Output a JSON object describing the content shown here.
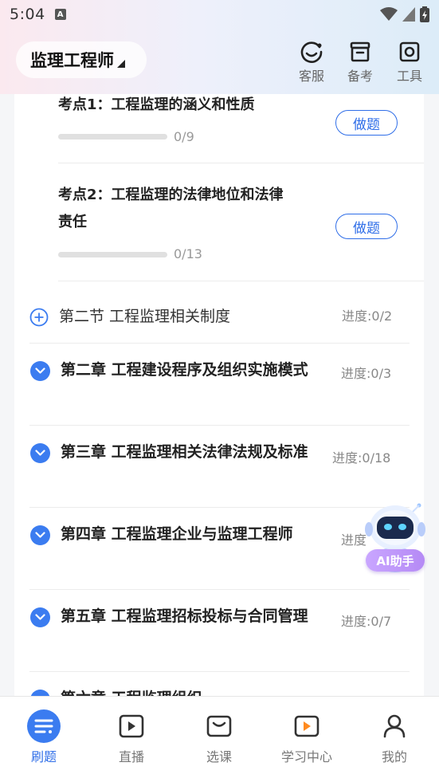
{
  "status": {
    "time": "5:04",
    "notif_letter": "A"
  },
  "header": {
    "title": "监理工程师",
    "buttons": [
      {
        "label": "客服",
        "icon": "customer-service-icon"
      },
      {
        "label": "备考",
        "icon": "archive-box-icon"
      },
      {
        "label": "工具",
        "icon": "toolbox-icon"
      }
    ]
  },
  "knowledge_points": [
    {
      "title": "考点1：工程监理的涵义和性质",
      "count": "0/9",
      "progress": 0,
      "action": "做题"
    },
    {
      "title": "考点2：工程监理的法律地位和法律责任",
      "count": "0/13",
      "progress": 0,
      "action": "做题"
    }
  ],
  "section": {
    "title": "第二节 工程监理相关制度",
    "progress": "进度:0/2"
  },
  "chapters": [
    {
      "title": "第二章 工程建设程序及组织实施模式",
      "progress": "进度:0/3"
    },
    {
      "title": "第三章 工程监理相关法律法规及标准",
      "progress": "进度:0/18"
    },
    {
      "title": "第四章 工程监理企业与监理工程师",
      "progress": "进度"
    },
    {
      "title": "第五章 工程监理招标投标与合同管理",
      "progress": "进度:0/7"
    },
    {
      "title": "第六章 工程监理组织",
      "progress": ""
    }
  ],
  "ai_assistant": {
    "label": "AI助手"
  },
  "tabs": [
    {
      "label": "刷题",
      "icon": "practice-list-icon",
      "active": true
    },
    {
      "label": "直播",
      "icon": "live-play-icon",
      "active": false
    },
    {
      "label": "选课",
      "icon": "course-bag-icon",
      "active": false
    },
    {
      "label": "学习中心",
      "icon": "study-center-icon",
      "active": false
    },
    {
      "label": "我的",
      "icon": "profile-icon",
      "active": false
    }
  ],
  "colors": {
    "accent": "#2f6ee8",
    "ai": "#b58af5"
  }
}
